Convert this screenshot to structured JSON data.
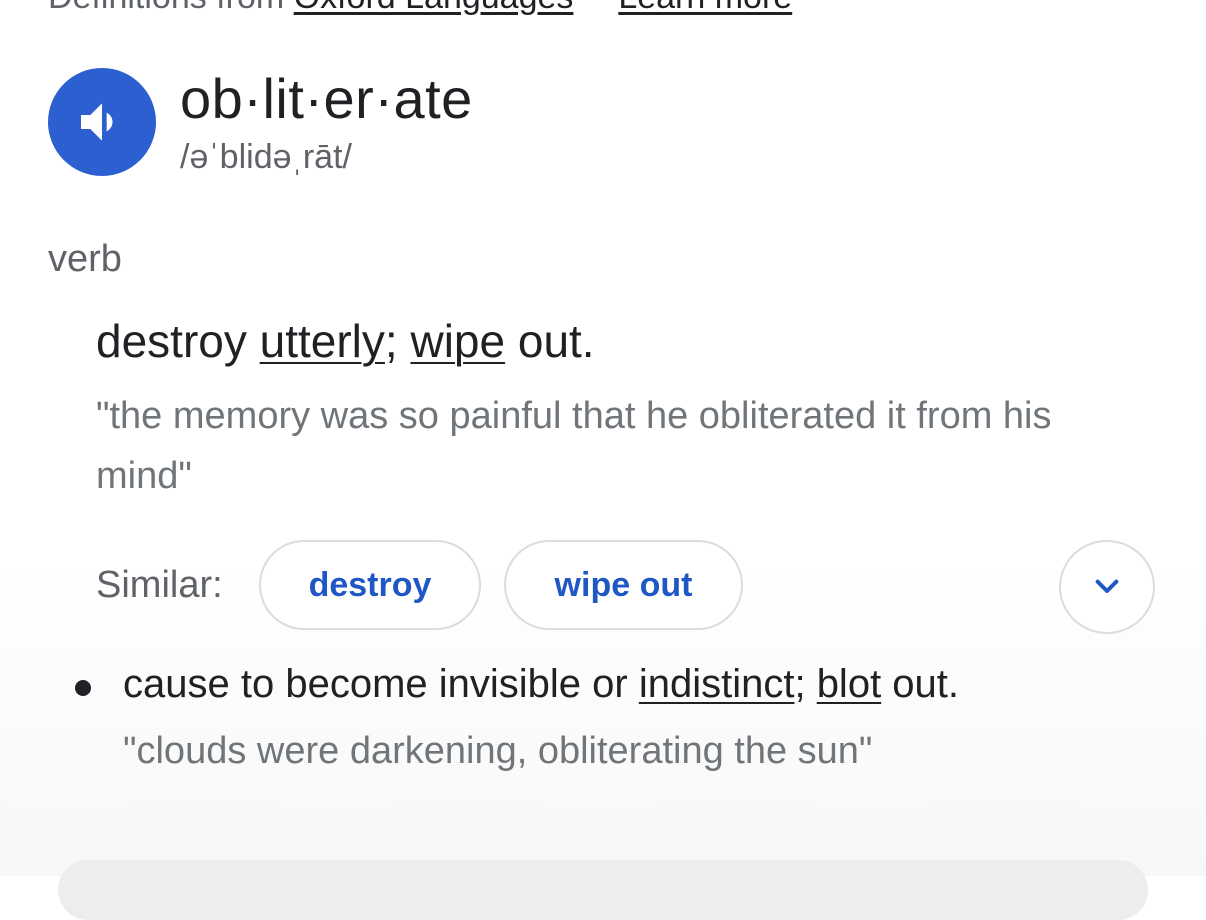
{
  "source": {
    "prefix": "Definitions from",
    "provider_link": "Oxford Languages",
    "learn_more_link": "Learn more"
  },
  "entry": {
    "headword": "ob·lit·er·ate",
    "phonetic": "/əˈblidəˌrāt/",
    "speaker_icon": "speaker-volume-icon",
    "part_of_speech": "verb"
  },
  "sense1": {
    "text_start": "destroy ",
    "link1": "utterly",
    "sep": "; ",
    "link2": "wipe",
    "text_end": " out.",
    "example": "\"the memory was so painful that he obliterated it from his mind\"",
    "similar_label": "Similar:",
    "similar": [
      "destroy",
      "wipe out"
    ],
    "expand_icon": "chevron-down-icon"
  },
  "sense2": {
    "text_start": "cause to become invisible or ",
    "link1": "indistinct",
    "sep": "; ",
    "link2": "blot",
    "text_end": " out.",
    "example": "\"clouds were darkening, obliterating the sun\""
  },
  "colors": {
    "accent_blue": "#2c5fcf",
    "chip_text": "#1f58c4",
    "muted_text": "#70757a"
  }
}
